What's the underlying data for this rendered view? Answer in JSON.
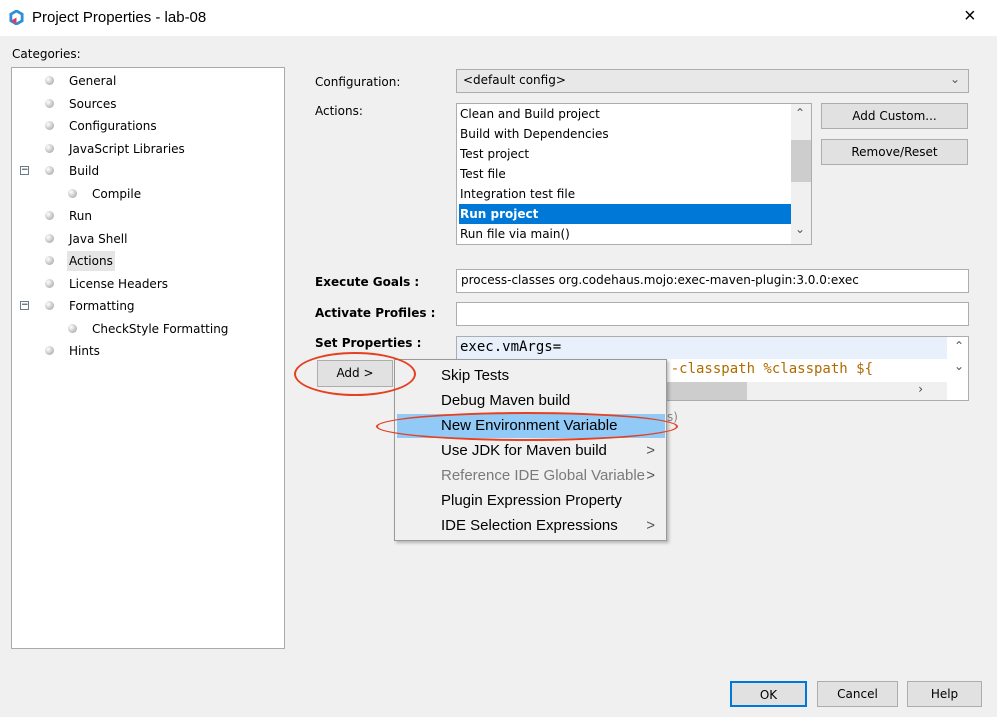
{
  "window": {
    "title": "Project Properties - lab-08",
    "close_icon": "×"
  },
  "categories": {
    "label": "Categories:",
    "items": [
      {
        "label": "General",
        "level": 0
      },
      {
        "label": "Sources",
        "level": 0
      },
      {
        "label": "Configurations",
        "level": 0
      },
      {
        "label": "JavaScript Libraries",
        "level": 0
      },
      {
        "label": "Build",
        "level": 0,
        "expanded": true
      },
      {
        "label": "Compile",
        "level": 1
      },
      {
        "label": "Run",
        "level": 0
      },
      {
        "label": "Java Shell",
        "level": 0
      },
      {
        "label": "Actions",
        "level": 0,
        "selected": true
      },
      {
        "label": "License Headers",
        "level": 0
      },
      {
        "label": "Formatting",
        "level": 0,
        "expanded": true
      },
      {
        "label": "CheckStyle Formatting",
        "level": 1
      },
      {
        "label": "Hints",
        "level": 0
      }
    ]
  },
  "configuration": {
    "label": "Configuration:",
    "value": "<default config>"
  },
  "actions": {
    "label": "Actions:",
    "items": [
      "Clean and Build project",
      "Build with Dependencies",
      "Test project",
      "Test file",
      "Integration test file",
      "Run project",
      "Run file via main()"
    ],
    "selected": "Run project",
    "add_custom": "Add Custom...",
    "remove_reset": "Remove/Reset"
  },
  "execute_goals": {
    "label": "Execute Goals :",
    "value": "process-classes org.codehaus.mojo:exec-maven-plugin:3.0.0:exec"
  },
  "activate_profiles": {
    "label": "Activate Profiles :",
    "value": ""
  },
  "set_properties": {
    "label": "Set Properties :",
    "line1": "exec.vmArgs=",
    "line2": "exec.args=${exec.vmArgs} -classpath %classpath ${",
    "add_button": "Add >",
    "hidden_suffix": "s)"
  },
  "add_menu": {
    "items": [
      {
        "label": "Skip Tests"
      },
      {
        "label": "Debug Maven build"
      },
      {
        "label": "New Environment Variable",
        "highlighted": true
      },
      {
        "label": "Use JDK for Maven build",
        "submenu": true
      },
      {
        "label": "Reference IDE Global Variable",
        "submenu": true,
        "disabled": true
      },
      {
        "label": "Plugin Expression Property"
      },
      {
        "label": "IDE Selection Expressions",
        "submenu": true
      }
    ],
    "submenu_arrow": ">"
  },
  "footer": {
    "ok": "OK",
    "cancel": "Cancel",
    "help": "Help"
  },
  "colors": {
    "selection": "#0078d7",
    "menu_highlight": "#91c9f7",
    "annotation": "#e5401f"
  }
}
